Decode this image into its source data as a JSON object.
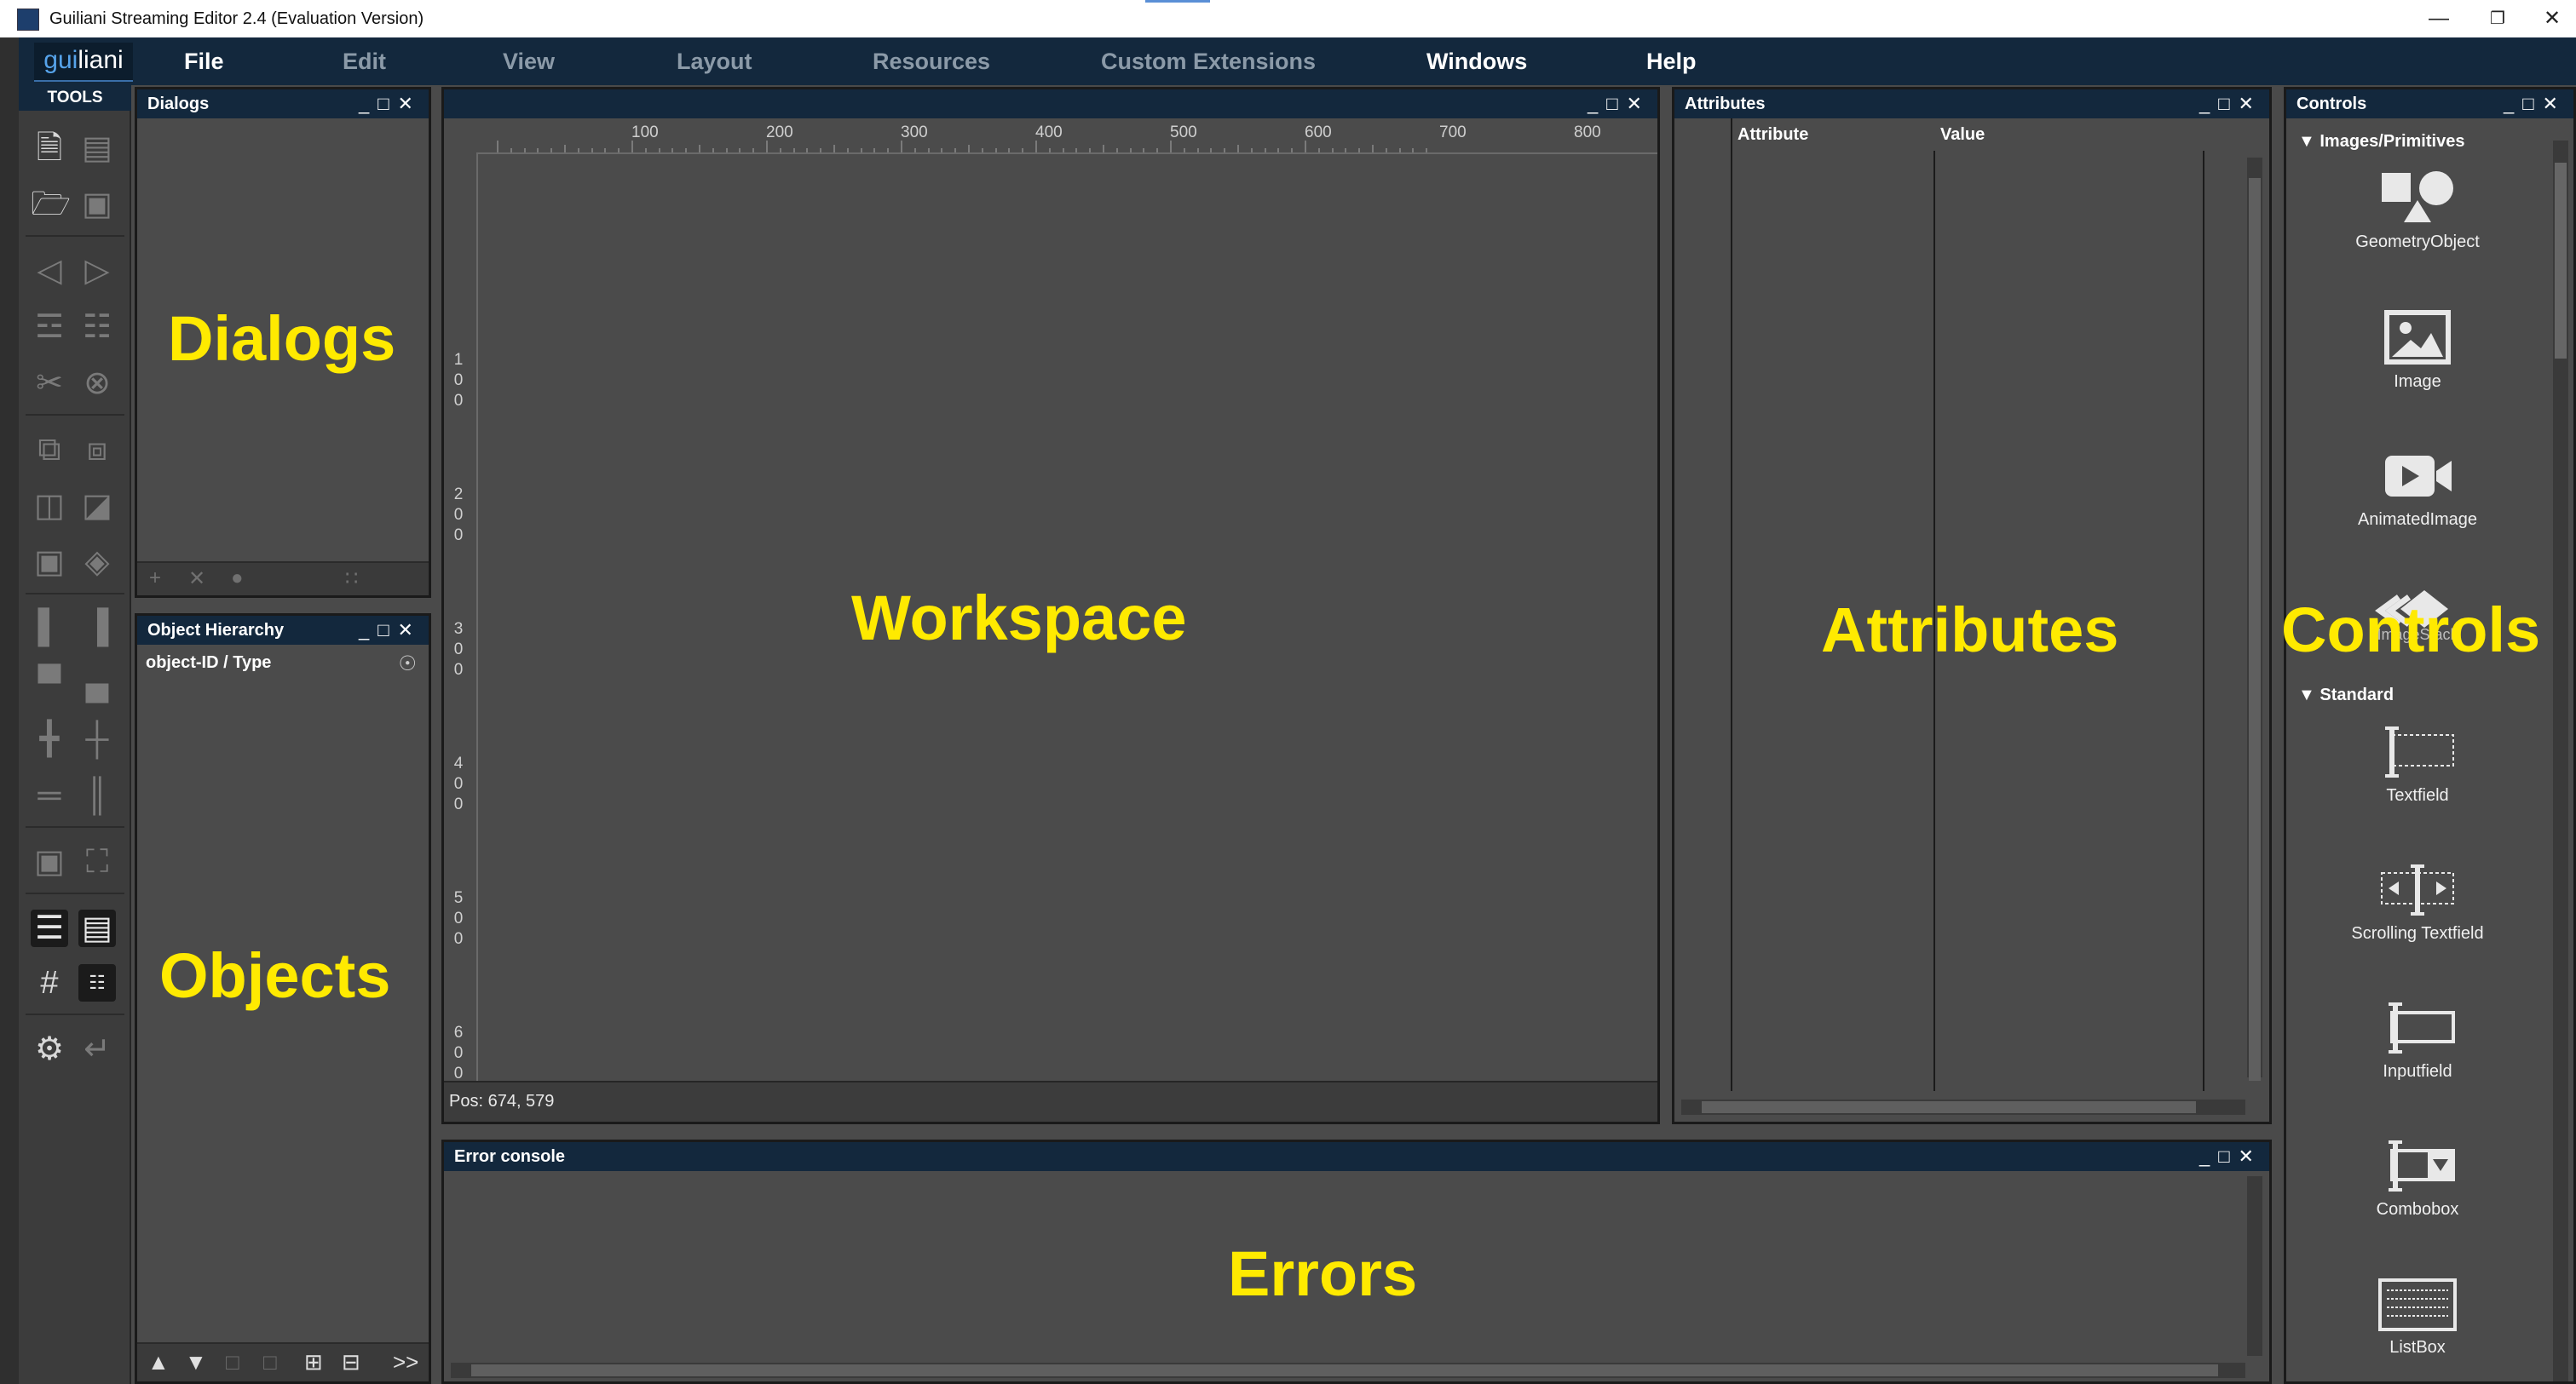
{
  "window": {
    "title": "Guiliani Streaming Editor 2.4 (Evaluation Version)"
  },
  "logo": {
    "part1": "gui",
    "part2": "liani"
  },
  "menu": [
    {
      "label": "File",
      "active": true
    },
    {
      "label": "Edit",
      "active": false
    },
    {
      "label": "View",
      "active": false
    },
    {
      "label": "Layout",
      "active": false
    },
    {
      "label": "Resources",
      "active": false
    },
    {
      "label": "Custom Extensions",
      "active": false
    },
    {
      "label": "Windows",
      "active": true
    },
    {
      "label": "Help",
      "active": true
    }
  ],
  "tools": {
    "header": "TOOLS"
  },
  "panels": {
    "dialogs": {
      "title": "Dialogs"
    },
    "hierarchy": {
      "title": "Object Hierarchy",
      "column": "object-ID / Type"
    },
    "attributes": {
      "title": "Attributes",
      "col_attribute": "Attribute",
      "col_value": "Value"
    },
    "errors": {
      "title": "Error console"
    },
    "controls": {
      "title": "Controls"
    }
  },
  "workspace": {
    "ruler_x": [
      "100",
      "200",
      "300",
      "400",
      "500",
      "600",
      "700",
      "800"
    ],
    "ruler_y": [
      [
        "1",
        "0",
        "0"
      ],
      [
        "2",
        "0",
        "0"
      ],
      [
        "3",
        "0",
        "0"
      ],
      [
        "4",
        "0",
        "0"
      ],
      [
        "5",
        "0",
        "0"
      ],
      [
        "6",
        "0",
        "0"
      ]
    ],
    "status": "Pos: 674, 579"
  },
  "annotations": {
    "dialogs": "Dialogs",
    "objects": "Objects",
    "workspace": "Workspace",
    "attributes": "Attributes",
    "controls": "Controls",
    "errors": "Errors"
  },
  "controls": {
    "cat_images": "Images/Primitives",
    "cat_standard": "Standard",
    "items": {
      "geometry": "GeometryObject",
      "image": "Image",
      "animated": "AnimatedImage",
      "imagestack": "ImageStack",
      "textfield": "Textfield",
      "scrolling": "Scrolling Textfield",
      "inputfield": "Inputfield",
      "combobox": "Combobox",
      "listbox": "ListBox"
    }
  },
  "colors": {
    "accent": "#13283d",
    "annotation": "#ffea00",
    "panel_bg": "#4b4b4b"
  }
}
